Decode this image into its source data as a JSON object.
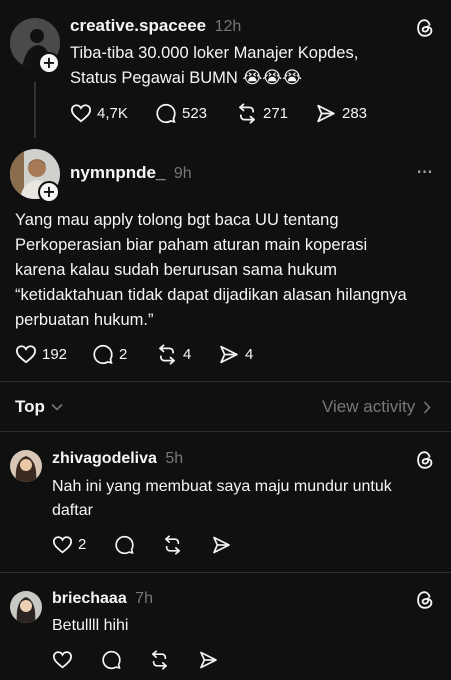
{
  "post1": {
    "username": "creative.spaceee",
    "time": "12h",
    "text_line1": "Tiba-tiba 30.000 loker Manajer Kopdes,",
    "text_line2": "Status Pegawai BUMN",
    "emoji": "😭😭😭",
    "likes": "4,7K",
    "comments": "523",
    "reposts": "271",
    "shares": "283"
  },
  "post2": {
    "username": "nymnpnde_",
    "time": "9h",
    "more": "···",
    "lines": [
      "Yang mau apply tolong bgt baca UU tentang",
      "Perkoperasian biar paham aturan main koperasi",
      "karena kalau sudah berurusan sama hukum",
      "“ketidaktahuan tidak dapat dijadikan alasan hilangnya",
      "perbuatan hukum.”"
    ],
    "likes": "192",
    "comments": "2",
    "reposts": "4",
    "shares": "4"
  },
  "sort": {
    "label": "Top",
    "view_activity": "View activity"
  },
  "reply1": {
    "username": "zhivagodeliva",
    "time": "5h",
    "line1": "Nah ini yang membuat saya maju mundur untuk",
    "line2": "daftar",
    "likes": "2"
  },
  "reply2": {
    "username": "briechaaa",
    "time": "7h",
    "text": "Betullll hihi"
  },
  "icons": {
    "like": "heart-icon",
    "comment": "comment-bubble-icon",
    "repost": "repost-icon",
    "share": "send-icon",
    "threads": "threads-logo-icon"
  }
}
